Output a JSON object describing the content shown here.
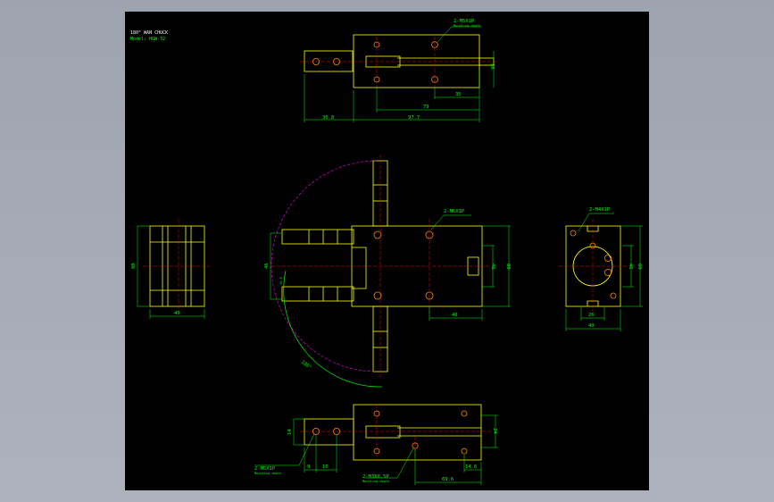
{
  "title": {
    "line1": "180° WAN CHUCK",
    "line2": "Model: HGW-32"
  },
  "annotations": {
    "thread_top": "2-M5X1P",
    "thread_top_note": "Mounting depth",
    "thread_center": "2-M6X1P",
    "thread_right": "2-M4X1P",
    "thread_bottom_left": "2-M5X1P",
    "thread_bottom_left_note": "Mounting depth",
    "thread_bottom_right": "2-M3X0.5P",
    "thread_bottom_right_note": "Mounting depth",
    "arc_angle": "180°",
    "label_small": "15.8"
  },
  "dimensions": {
    "top_view": [
      "26",
      "35",
      "79",
      "36.8",
      "97.7"
    ],
    "left_view": [
      "80",
      "40"
    ],
    "front_view": [
      "46",
      "46",
      "80",
      "40"
    ],
    "right_view": [
      "46",
      "80",
      "26",
      "40"
    ],
    "bottom_view": [
      "14",
      "24",
      "9",
      "16",
      "14.6",
      "69.6"
    ]
  },
  "colors": {
    "background": "#000000",
    "outline": "#ffff00",
    "dimension": "#00ff00",
    "centerline": "#ff0000",
    "hidden_arc": "#ff00ff",
    "text": "#00ff00"
  }
}
